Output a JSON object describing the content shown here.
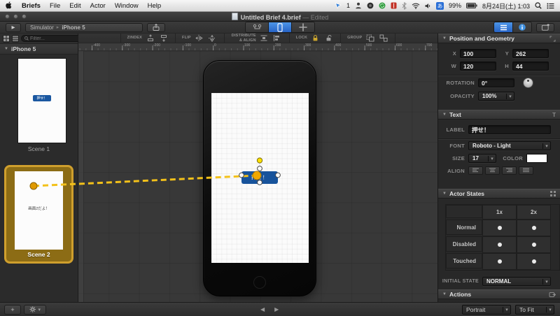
{
  "icons": {
    "play": "▶",
    "breadcrumb_sep": "▸",
    "disclosure": "▼",
    "chevron_down": "▾",
    "prev": "◀",
    "next": "▶",
    "plus": "+",
    "ime_glyph": "あ",
    "text_tool": "T"
  },
  "menubar": {
    "app_name": "Briefs",
    "items": [
      "File",
      "Edit",
      "Actor",
      "Window",
      "Help"
    ],
    "status": {
      "pointer_count": "1",
      "battery": "99%",
      "datetime": "8月24日(土) 1:03"
    },
    "status_icons": [
      "pointer-icon",
      "silhouette-icon",
      "lens-icon",
      "green-app-icon",
      "red-app-icon",
      "bluetooth-icon",
      "wifi-icon",
      "volume-icon",
      "ime-icon",
      "battery-icon",
      "spotlight-icon",
      "notification-center-icon"
    ]
  },
  "titlebar": {
    "title": "Untitled Brief 4.brief",
    "edited": "— Edited"
  },
  "toolbar": {
    "breadcrumb_root": "Simulator",
    "breadcrumb_device": "iPhone 5",
    "groups": {
      "zindex": "ZINDEX",
      "flip": "FLIP",
      "distribute": "DISTRIBUTE & ALIGN",
      "lock": "LOCK",
      "group": "GROUP"
    }
  },
  "sidebar": {
    "filter_placeholder": "Filter...",
    "device": "iPhone 5",
    "scenes": [
      {
        "name": "Scene 1",
        "button_label": "押せ！"
      },
      {
        "name": "Scene 2",
        "text": "画面2だよ！"
      }
    ]
  },
  "canvas": {
    "ruler_ticks": [
      "-400",
      "-300",
      "-200",
      "-100",
      "0",
      "100",
      "200",
      "300",
      "400",
      "500",
      "600",
      "700"
    ],
    "actor_button_label": "押せ！"
  },
  "inspector": {
    "position": {
      "title": "Position and Geometry",
      "x_label": "X",
      "x": "100",
      "y_label": "Y",
      "y": "262",
      "w_label": "W",
      "w": "120",
      "h_label": "H",
      "h": "44",
      "rotation_label": "ROTATION",
      "rotation": "0°",
      "opacity_label": "OPACITY",
      "opacity": "100%"
    },
    "text": {
      "title": "Text",
      "label_label": "LABEL",
      "label": "押せ！",
      "font_label": "FONT",
      "font": "Roboto - Light",
      "size_label": "SIZE",
      "size": "17",
      "color_label": "COLOR",
      "align_label": "ALIGN"
    },
    "states": {
      "title": "Actor States",
      "col1": "1x",
      "col2": "2x",
      "rows": [
        "Normal",
        "Disabled",
        "Touched"
      ],
      "initial_label": "INITIAL STATE",
      "initial": "NORMAL"
    },
    "actions": {
      "title": "Actions"
    }
  },
  "bottombar": {
    "portrait": "Portrait",
    "to_fit": "To Fit"
  }
}
